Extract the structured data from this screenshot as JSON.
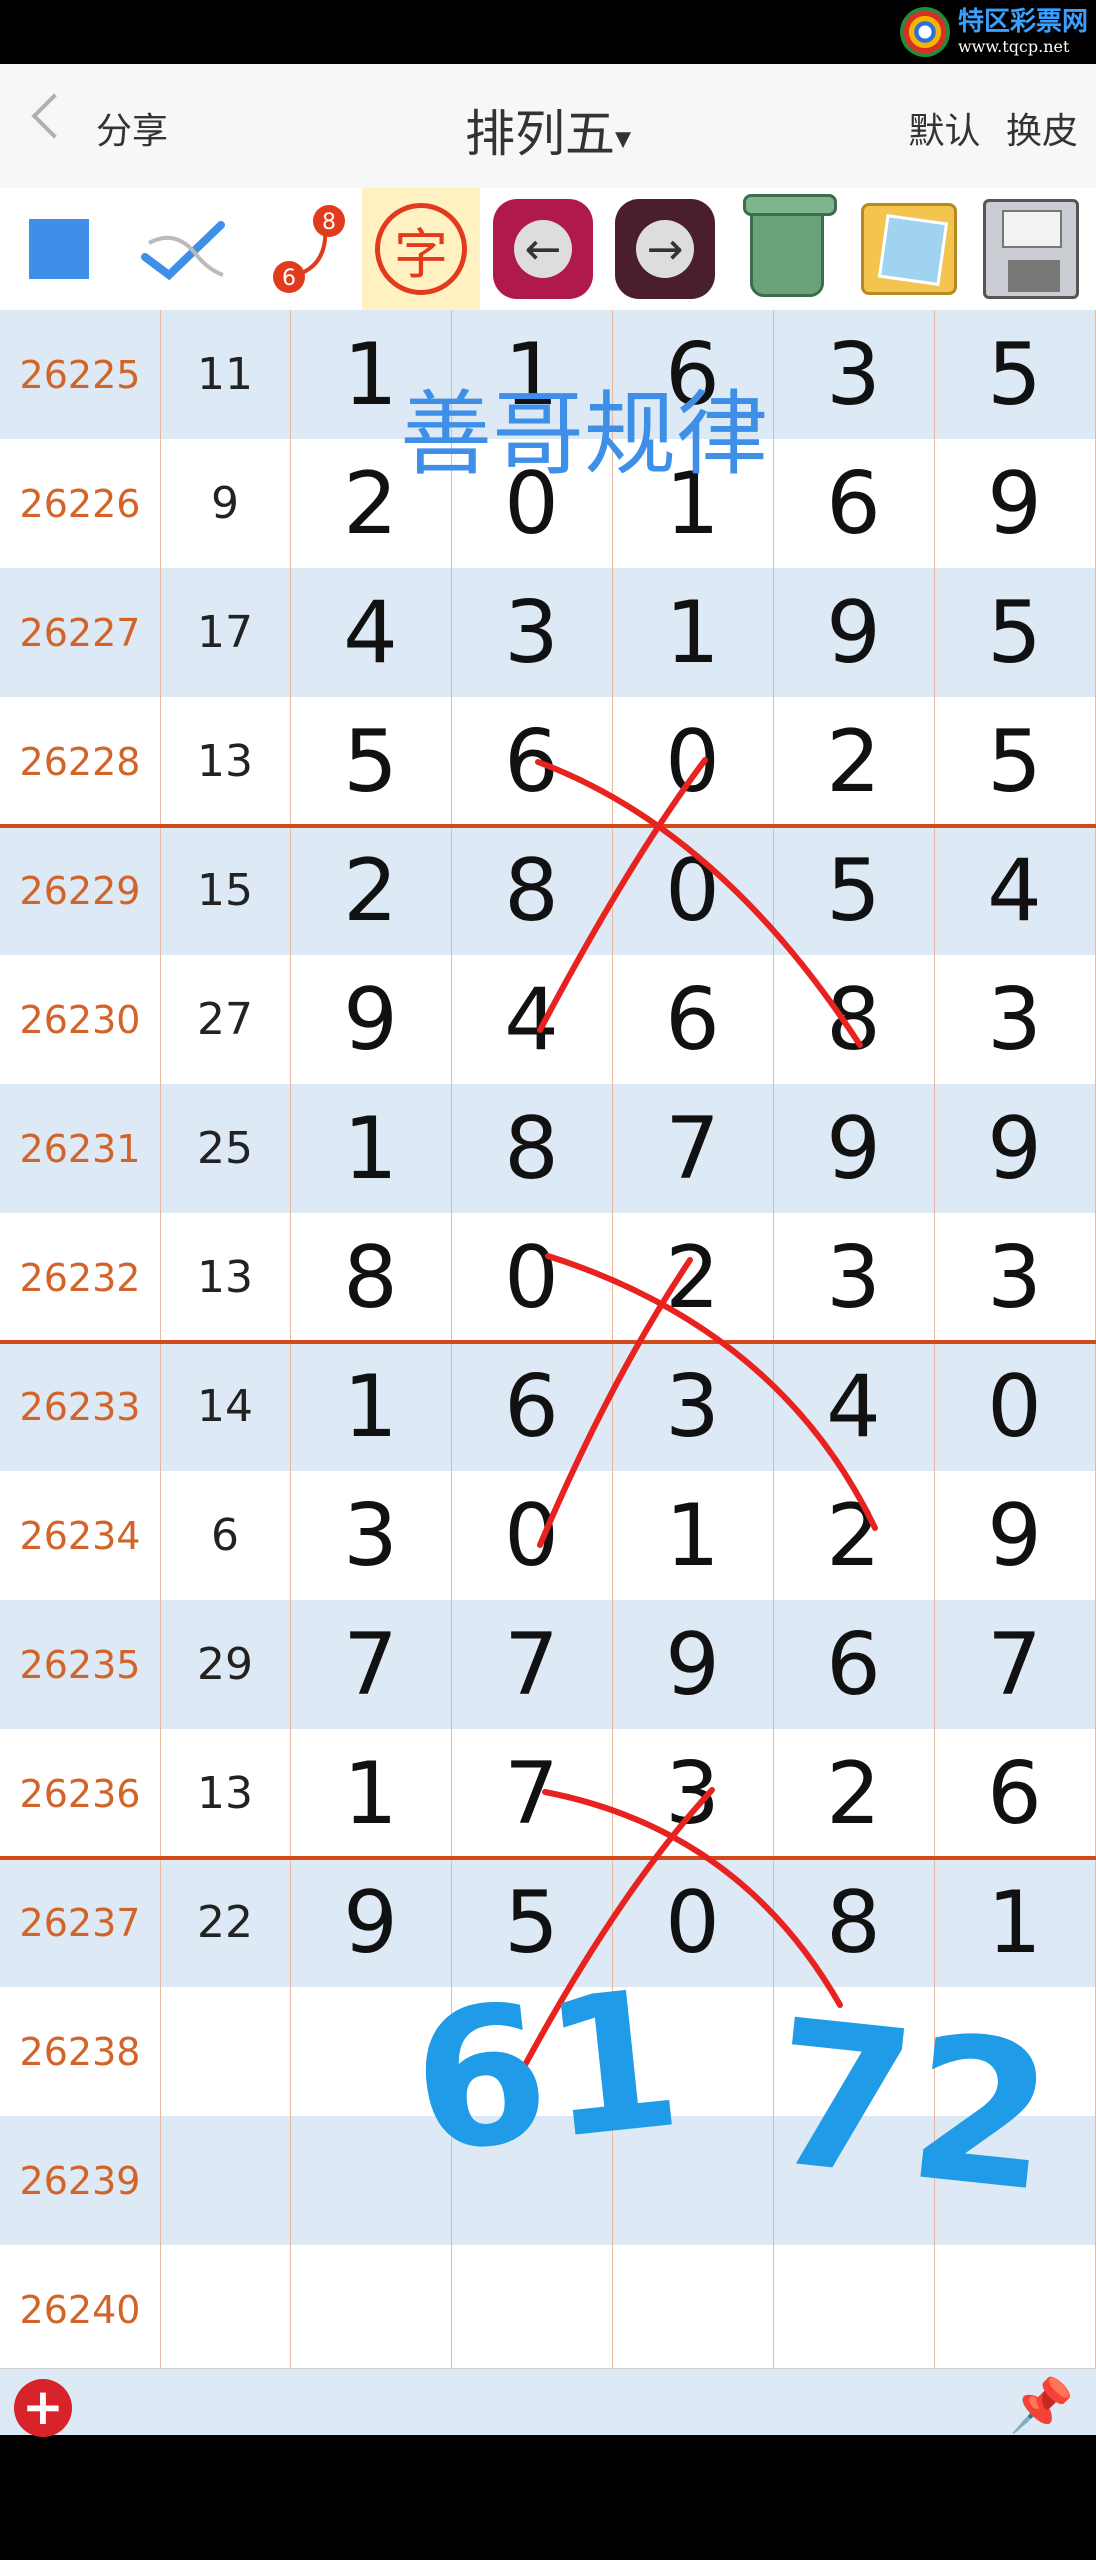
{
  "status_bar": {
    "logo_name": "特区彩票网",
    "logo_url": "www.tqcp.net"
  },
  "header": {
    "share_label": "分享",
    "title": "排列五",
    "title_arrow": "▾",
    "default_label": "默认",
    "skin_label": "换皮"
  },
  "toolbar": {
    "items": [
      {
        "icon": "blue-square-icon"
      },
      {
        "icon": "pen-check-icon"
      },
      {
        "icon": "link-6-8-icon",
        "labels": [
          "6",
          "8"
        ]
      },
      {
        "icon": "zi-char-icon",
        "label": "字"
      },
      {
        "icon": "undo-arrow-icon"
      },
      {
        "icon": "redo-arrow-icon"
      },
      {
        "icon": "trash-icon"
      },
      {
        "icon": "photos-icon"
      },
      {
        "icon": "floppy-save-icon"
      }
    ]
  },
  "watermark": "善哥规律",
  "rows": [
    {
      "issue": "26225",
      "sum": "11",
      "d": [
        "1",
        "1",
        "6",
        "3",
        "5"
      ]
    },
    {
      "issue": "26226",
      "sum": "9",
      "d": [
        "2",
        "0",
        "1",
        "6",
        "9"
      ]
    },
    {
      "issue": "26227",
      "sum": "17",
      "d": [
        "4",
        "3",
        "1",
        "9",
        "5"
      ]
    },
    {
      "issue": "26228",
      "sum": "13",
      "d": [
        "5",
        "6",
        "0",
        "2",
        "5"
      ]
    },
    {
      "issue": "26229",
      "sum": "15",
      "d": [
        "2",
        "8",
        "0",
        "5",
        "4"
      ]
    },
    {
      "issue": "26230",
      "sum": "27",
      "d": [
        "9",
        "4",
        "6",
        "8",
        "3"
      ]
    },
    {
      "issue": "26231",
      "sum": "25",
      "d": [
        "1",
        "8",
        "7",
        "9",
        "9"
      ]
    },
    {
      "issue": "26232",
      "sum": "13",
      "d": [
        "8",
        "0",
        "2",
        "3",
        "3"
      ]
    },
    {
      "issue": "26233",
      "sum": "14",
      "d": [
        "1",
        "6",
        "3",
        "4",
        "0"
      ]
    },
    {
      "issue": "26234",
      "sum": "6",
      "d": [
        "3",
        "0",
        "1",
        "2",
        "9"
      ]
    },
    {
      "issue": "26235",
      "sum": "29",
      "d": [
        "7",
        "7",
        "9",
        "6",
        "7"
      ]
    },
    {
      "issue": "26236",
      "sum": "13",
      "d": [
        "1",
        "7",
        "3",
        "2",
        "6"
      ]
    },
    {
      "issue": "26237",
      "sum": "22",
      "d": [
        "9",
        "5",
        "0",
        "8",
        "1"
      ]
    },
    {
      "issue": "26238",
      "sum": "",
      "d": [
        "",
        "",
        "",
        "",
        ""
      ]
    },
    {
      "issue": "26239",
      "sum": "",
      "d": [
        "",
        "",
        "",
        "",
        ""
      ]
    },
    {
      "issue": "26240",
      "sum": "",
      "d": [
        "",
        "",
        "",
        "",
        ""
      ]
    }
  ],
  "handwriting": {
    "left_text": "61",
    "right_text": "72"
  },
  "colors": {
    "issue_text": "#d2642a",
    "stripe": "#dde9f4",
    "separator": "#d24a17",
    "annotation_red": "#e8221f",
    "annotation_blue": "#1f9be8"
  }
}
